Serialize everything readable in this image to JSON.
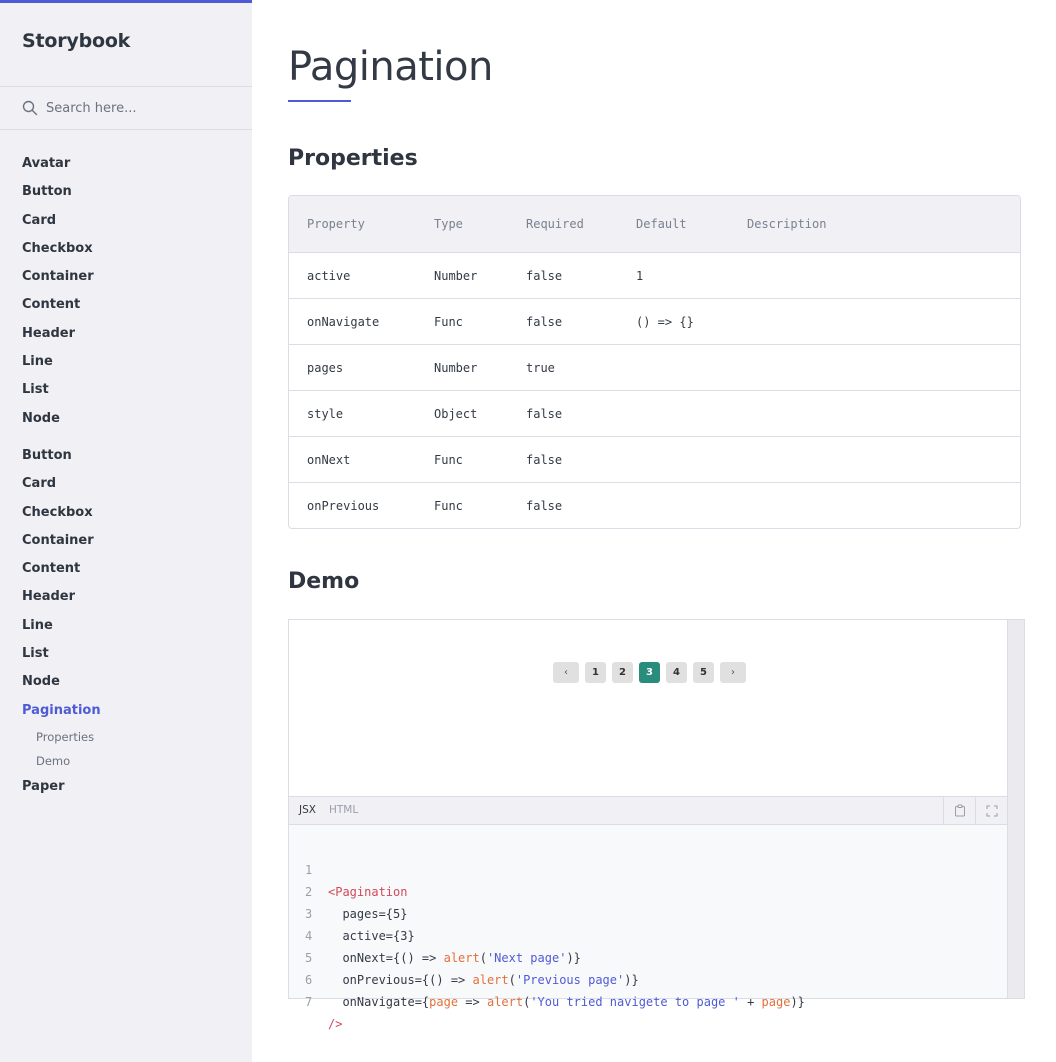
{
  "sidebar": {
    "brand": "Storybook",
    "search_placeholder": "Search here...",
    "group1": [
      "Avatar",
      "Button",
      "Card",
      "Checkbox",
      "Container",
      "Content",
      "Header",
      "Line",
      "List",
      "Node"
    ],
    "group2": [
      "Button",
      "Card",
      "Checkbox",
      "Container",
      "Content",
      "Header",
      "Line",
      "List",
      "Node"
    ],
    "active_item": "Pagination",
    "sub_items": [
      "Properties",
      "Demo"
    ],
    "after_item": "Paper"
  },
  "main": {
    "title": "Pagination",
    "properties_heading": "Properties",
    "demo_heading": "Demo"
  },
  "table": {
    "headers": [
      "Property",
      "Type",
      "Required",
      "Default",
      "Description"
    ],
    "rows": [
      [
        "active",
        "Number",
        "false",
        "1",
        ""
      ],
      [
        "onNavigate",
        "Func",
        "false",
        "() => {}",
        ""
      ],
      [
        "pages",
        "Number",
        "true",
        "",
        ""
      ],
      [
        "style",
        "Object",
        "false",
        "",
        ""
      ],
      [
        "onNext",
        "Func",
        "false",
        "",
        ""
      ],
      [
        "onPrevious",
        "Func",
        "false",
        "",
        ""
      ]
    ]
  },
  "demo": {
    "pagination": {
      "prev": "‹",
      "next": "›",
      "pages": [
        "1",
        "2",
        "3",
        "4",
        "5"
      ],
      "current": "3",
      "accent": "#2a8c7d"
    },
    "tabs": [
      "JSX",
      "HTML"
    ],
    "active_tab": "JSX",
    "code_lines": [
      {
        "n": "1",
        "text": "<Pagination"
      },
      {
        "n": "2",
        "text": "  pages={5}"
      },
      {
        "n": "3",
        "text": "  active={3}"
      },
      {
        "n": "4",
        "text": "  onNext={() => alert('Next page')}"
      },
      {
        "n": "5",
        "text": "  onPrevious={() => alert('Previous page')}"
      },
      {
        "n": "6",
        "text": "  onNavigate={page => alert('You tried navigete to page ' + page)}"
      },
      {
        "n": "7",
        "text": "/>"
      }
    ]
  },
  "colors": {
    "accent": "#4f5bd5",
    "sidebar_bg": "#f0f0f5",
    "tag": "#d14a5a",
    "function": "#e2703a",
    "string": "#4f5bd5"
  }
}
